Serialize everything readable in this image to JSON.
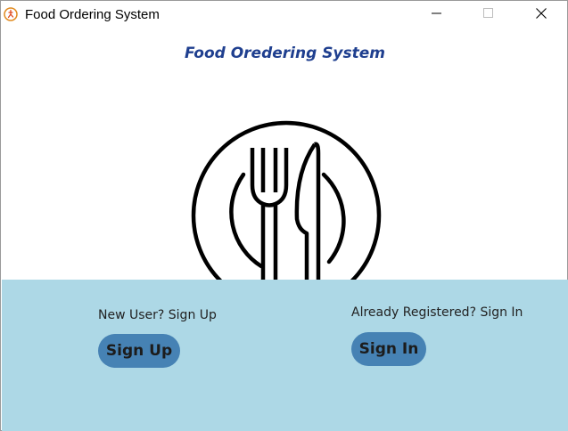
{
  "window": {
    "title": "Food Ordering System",
    "app_icon": "app-logo-icon",
    "controls": [
      "minimize-icon",
      "maximize-icon",
      "close-icon"
    ]
  },
  "main": {
    "heading": "Food Oredering System",
    "image_icon": "plate-fork-knife-icon"
  },
  "signup": {
    "prompt": "New User? Sign Up",
    "button_label": "Sign Up"
  },
  "signin": {
    "prompt": "Already Registered? Sign In",
    "button_label": "Sign In"
  },
  "colors": {
    "heading": "#1f3f8f",
    "panel_bg": "#add8e6",
    "button_bg": "#4682b4"
  }
}
